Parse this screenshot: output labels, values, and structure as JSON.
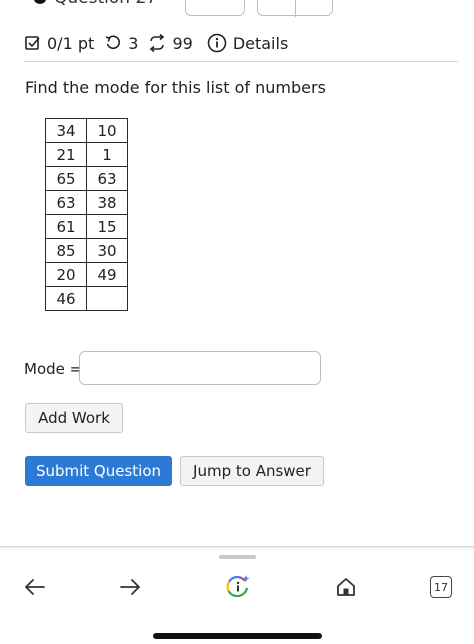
{
  "header": {
    "question_title": "Question 27"
  },
  "status": {
    "score": "0/1 pt",
    "retries": "3",
    "submissions": "99",
    "details_label": "Details"
  },
  "prompt": "Find the mode for this list of numbers",
  "table": {
    "rows": [
      [
        "34",
        "10"
      ],
      [
        "21",
        "1"
      ],
      [
        "65",
        "63"
      ],
      [
        "63",
        "38"
      ],
      [
        "61",
        "15"
      ],
      [
        "85",
        "30"
      ],
      [
        "20",
        "49"
      ],
      [
        "46",
        ""
      ]
    ]
  },
  "answer": {
    "label": "Mode =",
    "value": ""
  },
  "buttons": {
    "add_work": "Add Work",
    "submit": "Submit Question",
    "jump": "Jump to Answer"
  },
  "browser": {
    "tab_count": "17",
    "icons": [
      "back-arrow-icon",
      "forward-arrow-icon",
      "google-lens-icon",
      "home-icon",
      "tabs-icon"
    ]
  },
  "colors": {
    "submit_blue": "#2d7ad6",
    "border_gray": "#c9c9c9"
  }
}
